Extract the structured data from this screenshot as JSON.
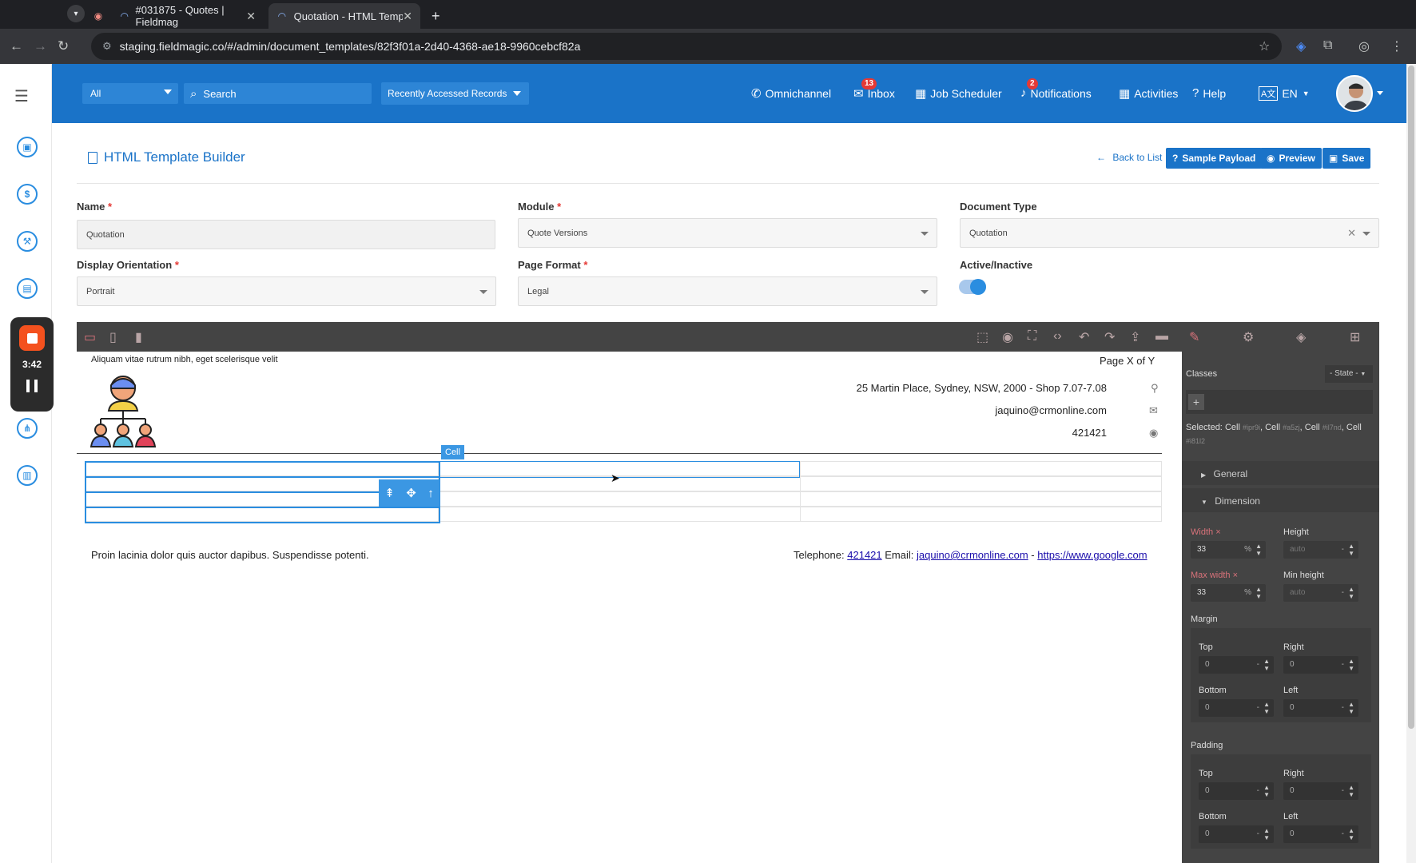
{
  "browser": {
    "tabs": [
      {
        "title": "#031875 - Quotes | Fieldmag"
      },
      {
        "title": "Quotation - HTML Template E"
      }
    ],
    "new_tab": "+",
    "url": "staging.fieldmagic.co/#/admin/document_templates/82f3f01a-2d40-4368-ae18-9960cebcf82a"
  },
  "recorder": {
    "time": "3:42"
  },
  "header": {
    "filter": "All",
    "search_placeholder": "Search",
    "recent": "Recently Accessed Records",
    "nav": [
      {
        "label": "Omnichannel",
        "icon": "phone-icon"
      },
      {
        "label": "Inbox",
        "icon": "envelope-icon",
        "badge": "13"
      },
      {
        "label": "Job Scheduler",
        "icon": "calendar-icon"
      },
      {
        "label": "Notifications",
        "icon": "bell-icon",
        "badge": "2"
      },
      {
        "label": "Activities",
        "icon": "calendar-check-icon"
      },
      {
        "label": "Help",
        "icon": "question-icon"
      },
      {
        "label": "EN",
        "icon": "language-icon"
      }
    ]
  },
  "page": {
    "title": "HTML Template Builder",
    "back": "Back to List",
    "sample_payload": "Sample Payload",
    "preview": "Preview",
    "save": "Save"
  },
  "form": {
    "name_label": "Name",
    "name_value": "Quotation",
    "module_label": "Module",
    "module_value": "Quote Versions",
    "doctype_label": "Document Type",
    "doctype_value": "Quotation",
    "orientation_label": "Display Orientation",
    "orientation_value": "Portrait",
    "format_label": "Page Format",
    "format_value": "Legal",
    "active_label": "Active/Inactive",
    "active": true,
    "required_mark": "*"
  },
  "document": {
    "top_left": "Aliquam vitae rutrum nibh, eget scelerisque velit",
    "page_of": "Page X of Y",
    "address": "25 Martin Place, Sydney, NSW, 2000 - Shop 7.07-7.08",
    "email": "jaquino@crmonline.com",
    "phone": "421421",
    "cell_badge": "Cell",
    "footer_left": "Proin lacinia dolor quis auctor dapibus. Suspendisse potenti.",
    "footer_tel_label": "Telephone:",
    "footer_tel": "421421",
    "footer_email_label": "Email:",
    "footer_email": "jaquino@crmonline.com",
    "footer_sep": "-",
    "footer_url": "https://www.google.com"
  },
  "style_panel": {
    "classes": "Classes",
    "state": "- State -",
    "add": "+",
    "selected_label": "Selected:",
    "selected_items": [
      {
        "name": "Cell",
        "id": "#ipr9i"
      },
      {
        "name": "Cell",
        "id": "#a5zj"
      },
      {
        "name": "Cell",
        "id": "#il7nd"
      },
      {
        "name": "Cell",
        "id": "#i81l2"
      }
    ],
    "general": "General",
    "dimension": "Dimension",
    "width_label": "Width",
    "width_value": "33",
    "height_label": "Height",
    "height_value": "auto",
    "maxwidth_label": "Max width",
    "maxwidth_value": "33",
    "minheight_label": "Min height",
    "minheight_value": "auto",
    "unit_percent": "%",
    "unit_dash": "-",
    "margin_label": "Margin",
    "padding_label": "Padding",
    "top": "Top",
    "right": "Right",
    "bottom": "Bottom",
    "left": "Left",
    "zero": "0",
    "remove_mark": "×"
  },
  "colors": {
    "brand_blue": "#1a73c8",
    "editor_dark": "#444444",
    "selection_blue": "#2a8de0",
    "recorder_red": "#f4511e"
  }
}
